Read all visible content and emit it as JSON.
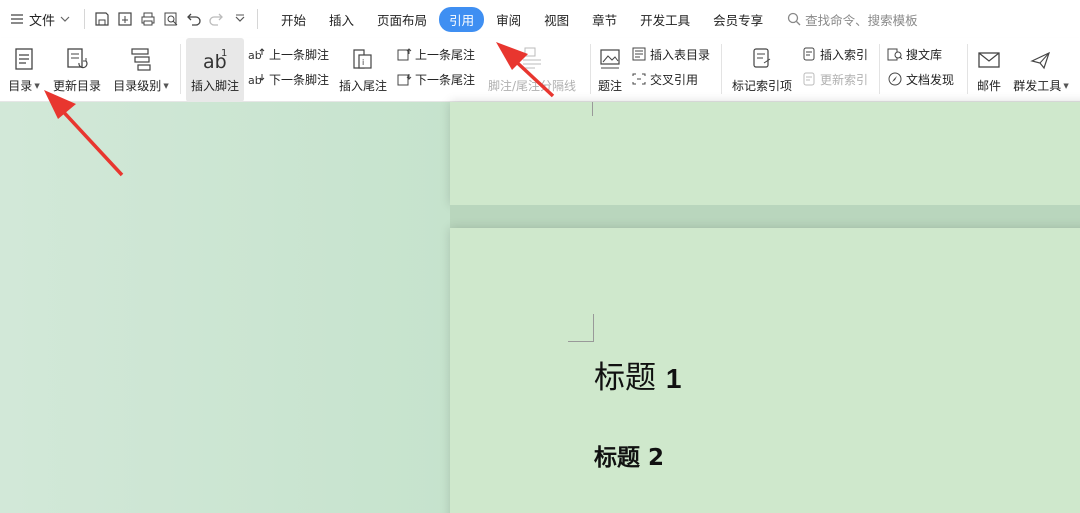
{
  "menubar": {
    "file_label": "文件",
    "tabs": [
      {
        "label": "开始",
        "active": false
      },
      {
        "label": "插入",
        "active": false
      },
      {
        "label": "页面布局",
        "active": false
      },
      {
        "label": "引用",
        "active": true
      },
      {
        "label": "审阅",
        "active": false
      },
      {
        "label": "视图",
        "active": false
      },
      {
        "label": "章节",
        "active": false
      },
      {
        "label": "开发工具",
        "active": false
      },
      {
        "label": "会员专享",
        "active": false
      }
    ],
    "search_placeholder": "查找命令、搜索模板"
  },
  "ribbon": {
    "toc": "目录",
    "update_toc": "更新目录",
    "toc_level": "目录级别",
    "insert_footnote": "插入脚注",
    "prev_footnote": "上一条脚注",
    "next_footnote": "下一条脚注",
    "insert_endnote": "插入尾注",
    "prev_endnote": "上一条尾注",
    "next_endnote": "下一条尾注",
    "note_separator": "脚注/尾注分隔线",
    "caption": "题注",
    "insert_table_of_figures": "插入表目录",
    "cross_reference": "交叉引用",
    "mark_index_entry": "标记索引项",
    "insert_index": "插入索引",
    "update_index": "更新索引",
    "search_library": "搜文库",
    "doc_discovery": "文档发现",
    "mail": "邮件",
    "group_tools": "群发工具"
  },
  "document": {
    "heading1_text": "标题",
    "heading1_num": "1",
    "heading2": "标题 2"
  },
  "colors": {
    "accent": "#3f8ff2",
    "arrow": "#e8362f",
    "page_bg": "#cfe8cc"
  }
}
